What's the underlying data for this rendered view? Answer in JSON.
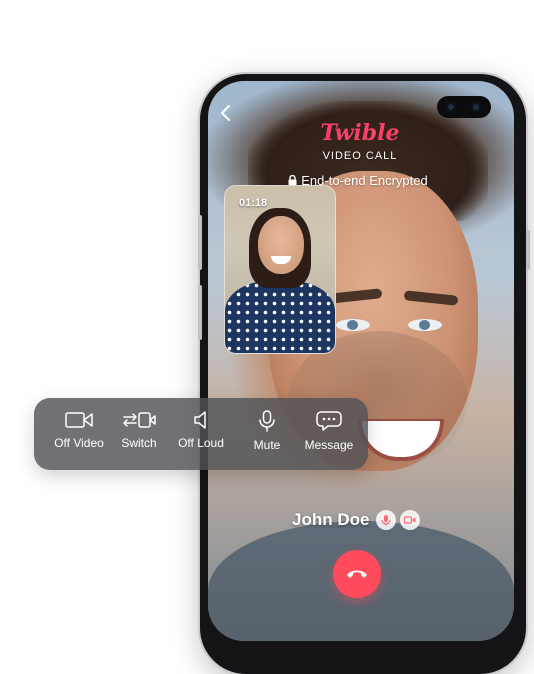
{
  "brand": {
    "logo_text": "Twible",
    "accent": "#ff3f6a"
  },
  "call": {
    "title": "VIDEO CALL",
    "encryption_label": "End-to-end Encrypted",
    "duration": "01:18",
    "caller_name": "John Doe"
  },
  "controls": [
    {
      "label": "Off Video",
      "icon": "video-camera-icon"
    },
    {
      "label": "Switch",
      "icon": "switch-camera-icon"
    },
    {
      "label": "Off Loud",
      "icon": "speaker-icon"
    },
    {
      "label": "Mute",
      "icon": "microphone-icon"
    },
    {
      "label": "Message",
      "icon": "chat-bubble-icon"
    }
  ],
  "colors": {
    "end_call": "#ff4b5c",
    "control_bar": "#505256"
  }
}
